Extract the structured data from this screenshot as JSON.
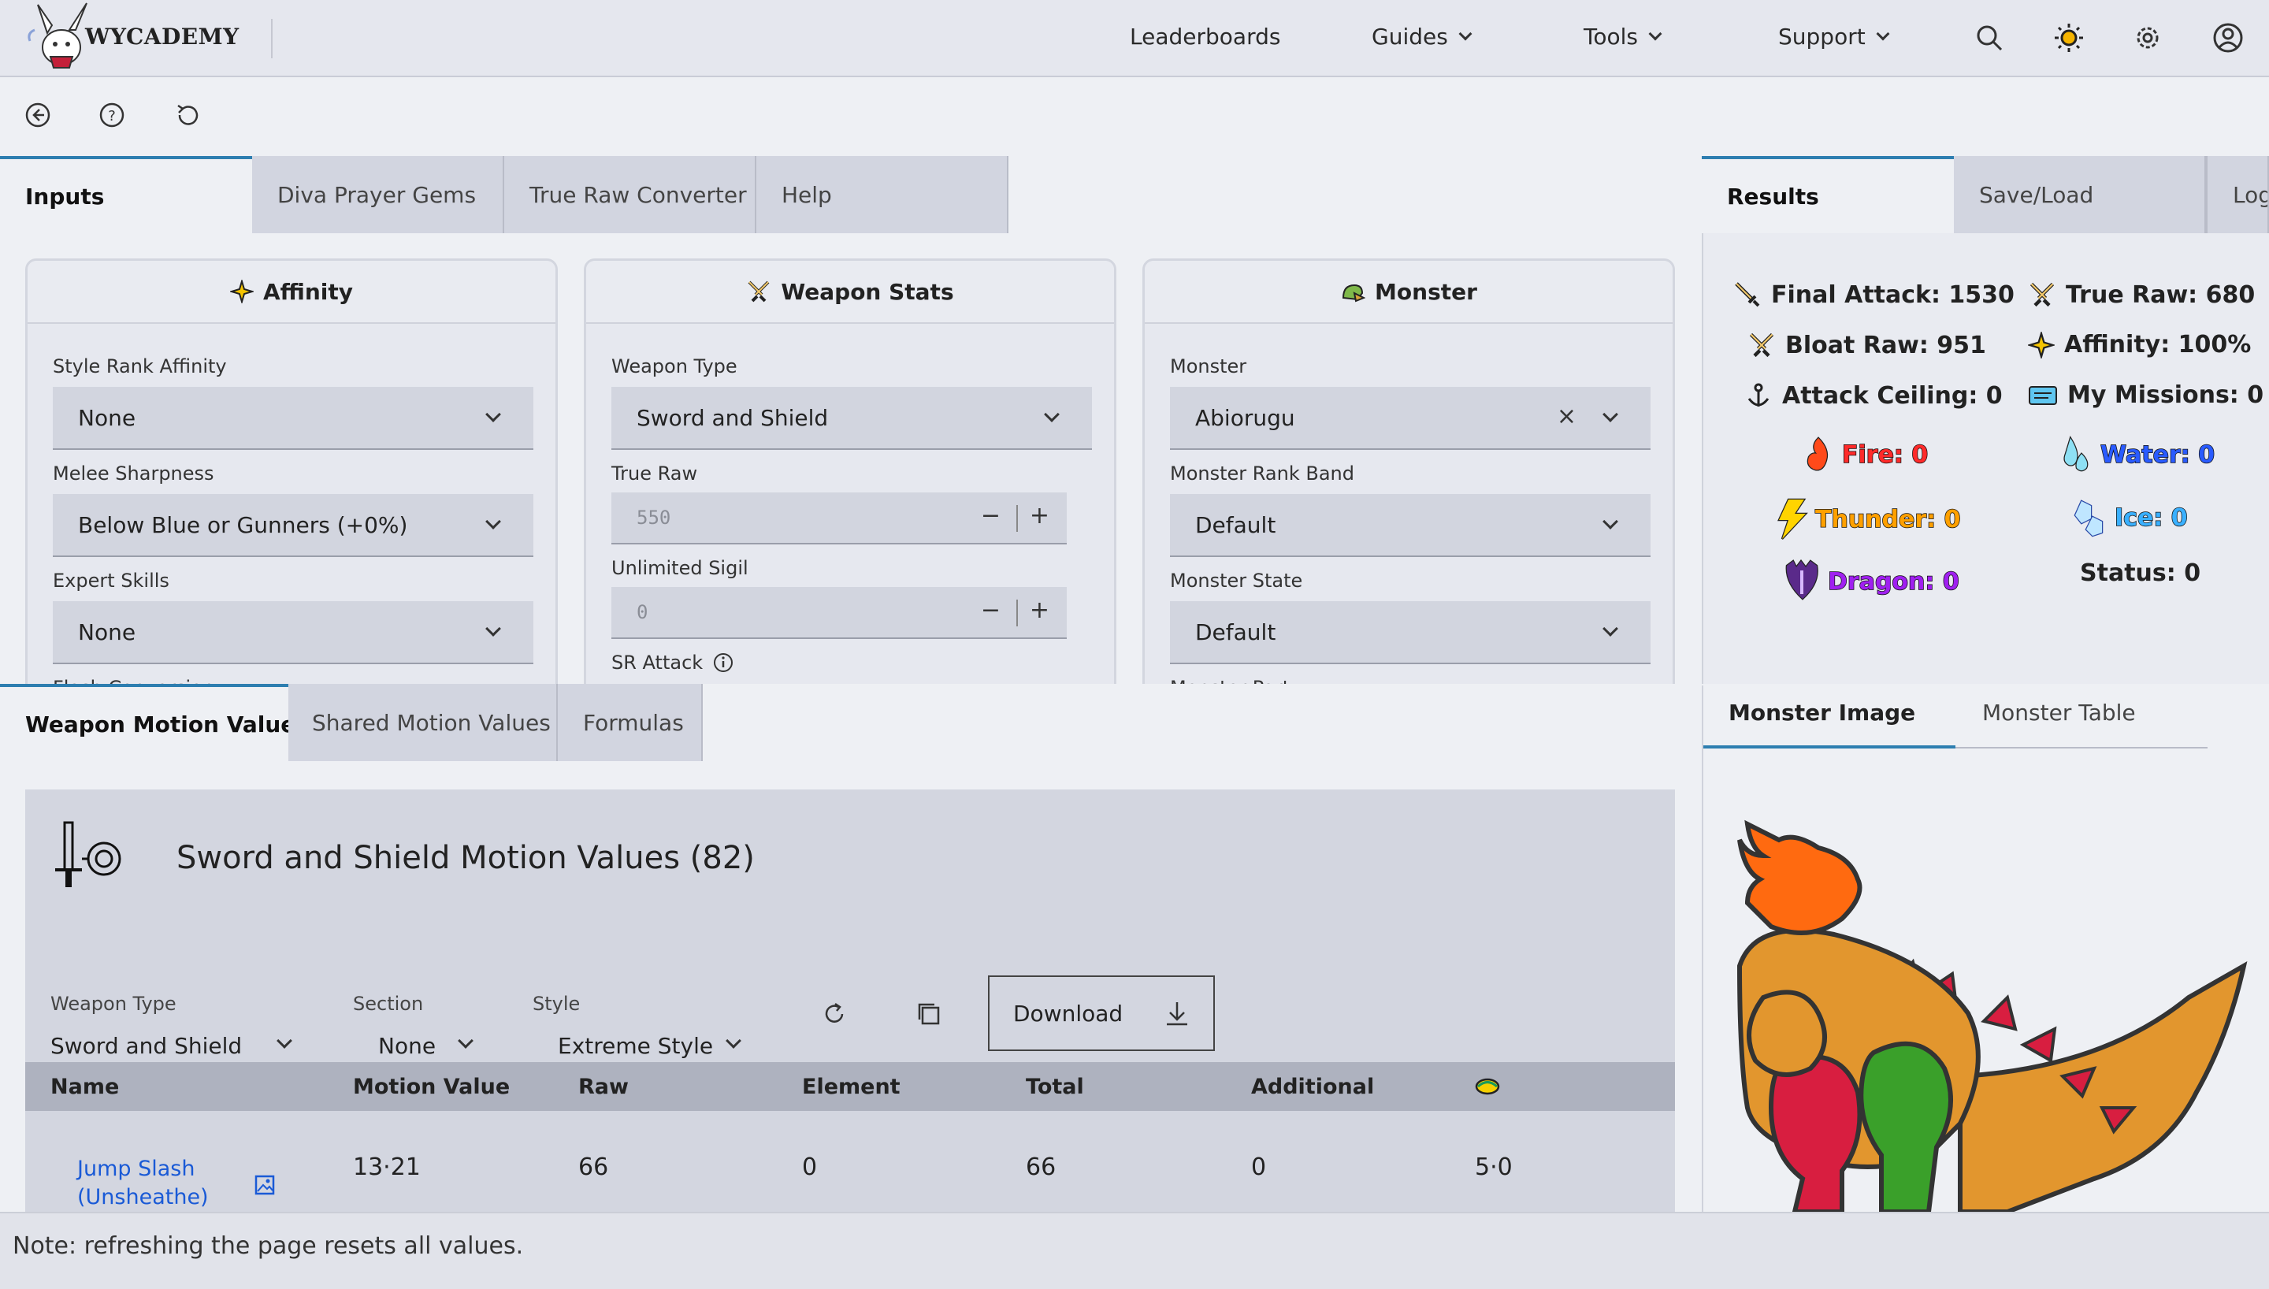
{
  "header": {
    "brand": "WYCADEMY",
    "nav": [
      "Leaderboards",
      "Guides",
      "Tools",
      "Support"
    ],
    "icons": [
      "search-icon",
      "sun-icon",
      "gear-icon",
      "user-icon"
    ]
  },
  "toolbar": {
    "icons": [
      "back-icon",
      "help-icon",
      "reset-icon"
    ]
  },
  "input_tabs": [
    "Inputs",
    "Diva Prayer Gems",
    "True Raw Converter",
    "Help"
  ],
  "result_tabs": [
    "Results",
    "Save/Load",
    "Log"
  ],
  "cards": {
    "affinity": {
      "title": "Affinity",
      "fields": [
        {
          "label": "Style Rank Affinity",
          "value": "None"
        },
        {
          "label": "Melee Sharpness",
          "value": "Below Blue or Gunners (+0%)"
        },
        {
          "label": "Expert Skills",
          "value": "None"
        },
        {
          "label": "Flash Conversion"
        }
      ]
    },
    "weapon": {
      "title": "Weapon Stats",
      "weapon_type_label": "Weapon Type",
      "weapon_type_value": "Sword and Shield",
      "true_raw_label": "True Raw",
      "true_raw_value": "550",
      "sigil_label": "Unlimited Sigil",
      "sigil_value": "0",
      "sr_attack_label": "SR Attack"
    },
    "monster": {
      "title": "Monster",
      "monster_label": "Monster",
      "monster_value": "Abiorugu",
      "rank_label": "Monster Rank Band",
      "rank_value": "Default",
      "state_label": "Monster State",
      "state_value": "Default",
      "part_label": "Monster Part"
    }
  },
  "results": {
    "final_attack": "Final Attack: 1530",
    "true_raw": "True Raw: 680",
    "bloat_raw": "Bloat Raw: 951",
    "affinity": "Affinity: 100%",
    "attack_ceiling": "Attack Ceiling: 0",
    "my_missions": "My Missions: 0",
    "fire": "Fire: 0",
    "water": "Water: 0",
    "thunder": "Thunder: 0",
    "ice": "Ice: 0",
    "dragon": "Dragon: 0",
    "status": "Status: 0",
    "colors": {
      "fire": "#ff2a2a",
      "water": "#2a5bff",
      "thunder": "#ffa000",
      "ice": "#3ab0ff",
      "dragon": "#a020f0"
    }
  },
  "motion_tabs": [
    "Weapon Motion Values",
    "Shared Motion Values",
    "Formulas"
  ],
  "motion": {
    "title": "Sword and Shield Motion Values (82)",
    "filters": [
      {
        "label": "Weapon Type",
        "value": "Sword and Shield"
      },
      {
        "label": "Section",
        "value": "None"
      },
      {
        "label": "Style",
        "value": "Extreme Style"
      }
    ],
    "download_label": "Download",
    "columns": [
      "Name",
      "Motion Value",
      "Raw",
      "Element",
      "Total",
      "Additional"
    ],
    "rows": [
      {
        "name_line1": "Jump Slash",
        "name_line2": "(Unsheathe)",
        "motion_value": "13·21",
        "raw": "66",
        "element": "0",
        "total": "66",
        "additional": "0",
        "speed": "5·0"
      }
    ]
  },
  "monster_panel": {
    "tabs": [
      "Monster Image",
      "Monster Table"
    ]
  },
  "footer": {
    "note": "Note: refreshing the page resets all values."
  }
}
